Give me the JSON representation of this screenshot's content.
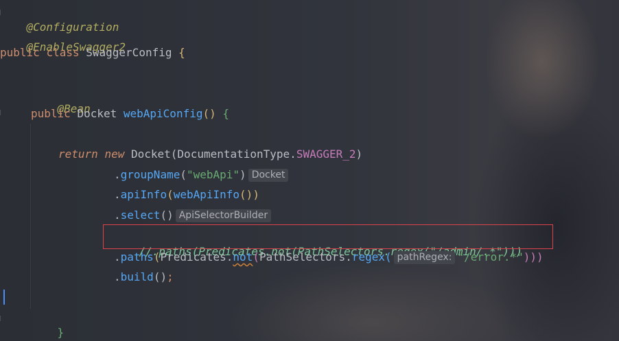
{
  "code": {
    "annotation_configuration": "@Configuration",
    "annotation_enable_swagger": "@EnableSwagger2",
    "class_decl": {
      "kw_public": "public",
      "kw_class": "class",
      "class_name": "SwaggerConfig",
      "open_brace": "{"
    },
    "annotation_bean": "@Bean",
    "method_decl": {
      "kw_public": "public",
      "return_type": "Docket",
      "method_name": "webApiConfig",
      "parens": "()",
      "open_brace": "{"
    },
    "return_line": {
      "kw_return": "return",
      "kw_new": "new",
      "type": "Docket",
      "open_paren": "(",
      "arg_class": "DocumentationType.",
      "arg_const": "SWAGGER_2",
      "close_paren": ")"
    },
    "groupname_line": {
      "dot": ".",
      "method": "groupName",
      "open_paren": "(",
      "arg": "\"webApi\"",
      "close_paren": ")",
      "hint": "Docket"
    },
    "apiinfo_line": {
      "dot": ".",
      "method": "apiInfo",
      "open_paren": "(",
      "arg_method": "webApiInfo",
      "arg_parens": "()",
      "close_paren": ")"
    },
    "select_line": {
      "dot": ".",
      "method": "select",
      "parens": "()",
      "hint": "ApiSelectorBuilder"
    },
    "commented_line": "//.paths(Predicates.not(PathSelectors.regex(\"/admin/.*\")))",
    "paths_line": {
      "dot": ".",
      "method": "paths",
      "open_paren": "(",
      "class1": "Predicates.",
      "not_method": "not",
      "open_paren2": "(",
      "class2": "PathSelectors.",
      "regex_method": "regex",
      "open_paren3": "(",
      "hint": "pathRegex:",
      "arg": "\"/error.*\"",
      "close_parens": ")))"
    },
    "build_line": {
      "dot": ".",
      "method": "build",
      "parens": "()",
      "semicolon": ";"
    },
    "closing_brace": "}"
  },
  "colors": {
    "annotation": "#b3ae60",
    "keyword": "#cf8e6d",
    "method": "#56a8f5",
    "string": "#6aab73",
    "constant": "#c77dbb",
    "comment": "#7ec699",
    "highlight_border": "#e0424b",
    "caret": "#4d8df5"
  }
}
